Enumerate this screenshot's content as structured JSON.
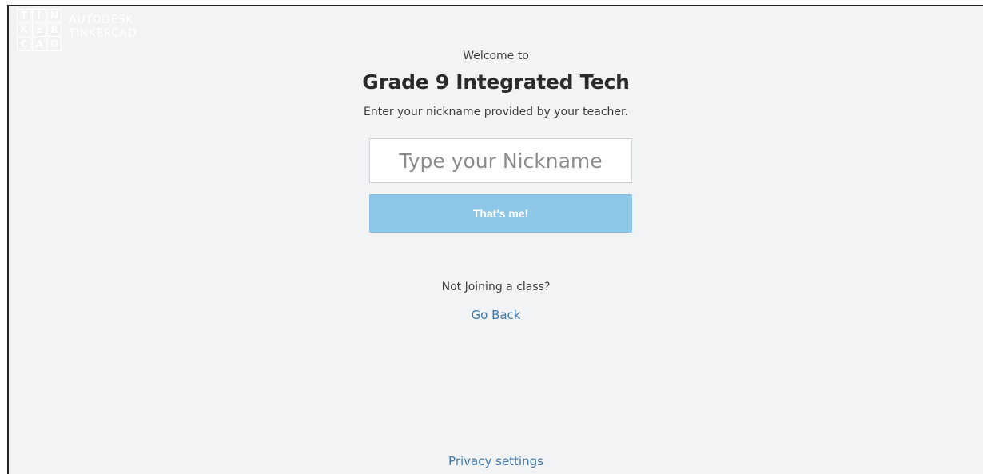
{
  "brand": {
    "logo_letters": [
      "T",
      "I",
      "N",
      "K",
      "E",
      "R",
      "C",
      "A",
      "D"
    ],
    "line1": "AUTODESK",
    "line2": "TINKERCAD"
  },
  "join": {
    "welcome": "Welcome to",
    "class_name": "Grade 9 Integrated Tech",
    "instructions": "Enter your nickname provided by your teacher.",
    "nickname_placeholder": "Type your Nickname",
    "nickname_value": "",
    "submit_label": "That's me!"
  },
  "alt": {
    "prompt": "Not Joining a class?",
    "back_link": "Go Back"
  },
  "footer": {
    "privacy_link": "Privacy settings"
  },
  "colors": {
    "background": "#f2f3f4",
    "button": "#8fc7e8",
    "link": "#3e77ab"
  }
}
